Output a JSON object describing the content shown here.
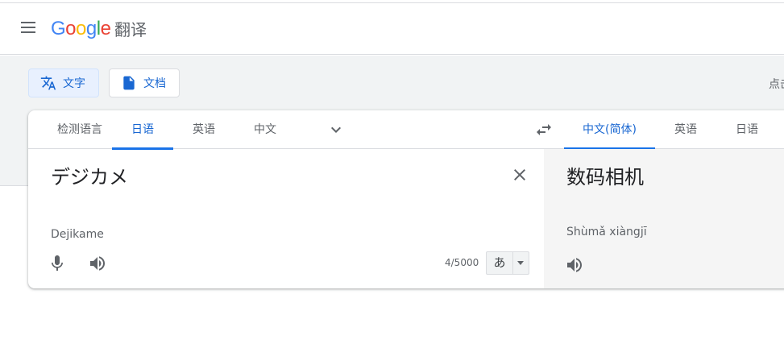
{
  "header": {
    "logo_letters": [
      "G",
      "o",
      "o",
      "g",
      "l",
      "e"
    ],
    "logo_suffix": "翻译",
    "menu_icon": "hamburger-menu-icon"
  },
  "modes": [
    {
      "label": "文字",
      "icon": "translate-icon",
      "active": true
    },
    {
      "label": "文档",
      "icon": "document-icon",
      "active": false
    }
  ],
  "right_cutoff_text": "点击",
  "source_languages": [
    "检测语言",
    "日语",
    "英语",
    "中文"
  ],
  "source_active": "日语",
  "target_languages": [
    "中文(简体)",
    "英语",
    "日语"
  ],
  "target_active": "中文(简体)",
  "source": {
    "text": "デジカメ",
    "romanization": "Dejikame",
    "char_count": "4/5000",
    "ime_label": "あ"
  },
  "target": {
    "text": "数码相机",
    "pinyin": "Shùmǎ xiàngjī"
  },
  "colors": {
    "accent": "#1a73e8",
    "accent_text": "#1967d2",
    "band": "#f1f3f4",
    "target_panel": "#f5f5f5"
  }
}
